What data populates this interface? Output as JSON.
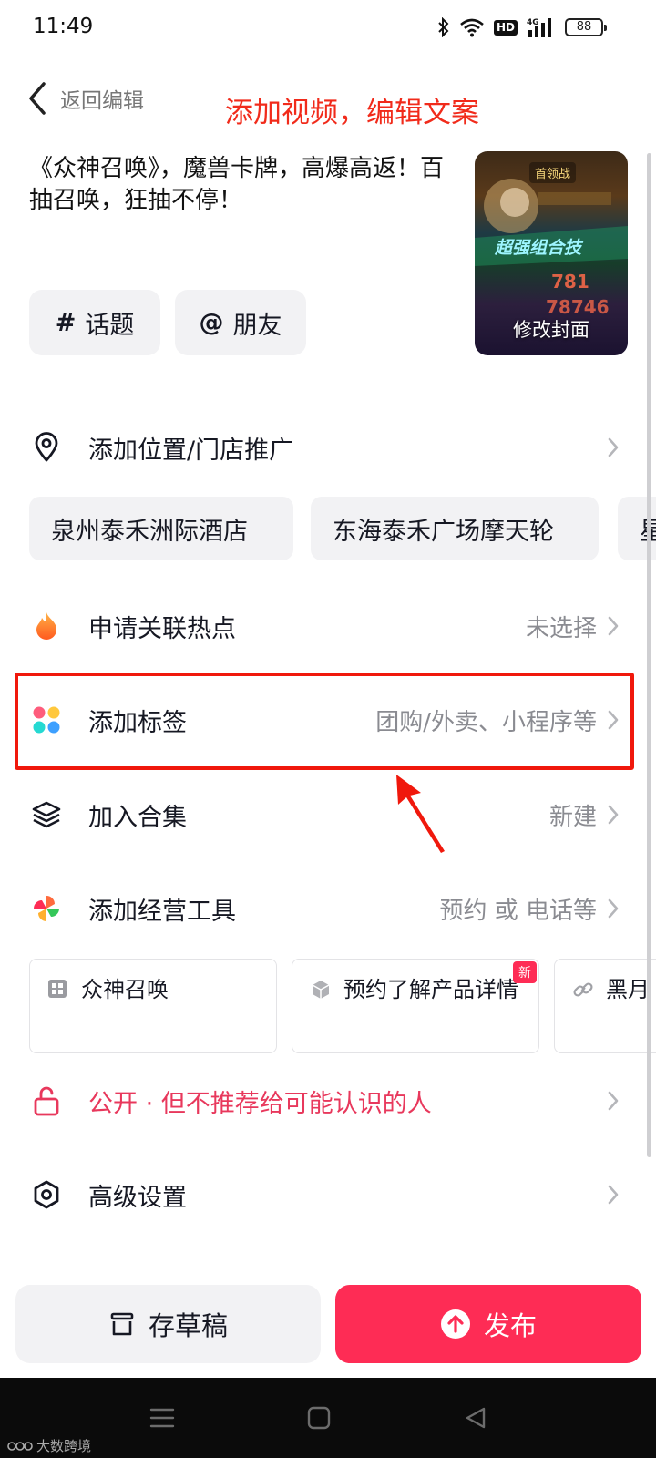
{
  "status_bar": {
    "time": "11:49",
    "network": "4G",
    "hd": "HD",
    "battery": "88"
  },
  "header": {
    "back_label": "返回编辑",
    "annotation": "添加视频，编辑文案"
  },
  "caption": "《众神召唤》，魔兽卡牌，高爆高返！百抽召唤，狂抽不停！",
  "cover": {
    "label": "修改封面",
    "art_text": "超强组合技",
    "badge": "首领战"
  },
  "chips": {
    "topic": {
      "symbol": "#",
      "label": "话题"
    },
    "friend": {
      "symbol": "@",
      "label": "朋友"
    }
  },
  "location": {
    "label": "添加位置/门店推广",
    "suggestions": [
      "泉州泰禾洲际酒店",
      "东海泰禾广场摩天轮",
      "星"
    ]
  },
  "hotspot": {
    "label": "申请关联热点",
    "value": "未选择"
  },
  "tags": {
    "label": "添加标签",
    "value": "团购/外卖、小程序等"
  },
  "collection": {
    "label": "加入合集",
    "value": "新建"
  },
  "business_tools": {
    "label": "添加经营工具",
    "value": "预约 或 电话等",
    "cards": [
      {
        "label": "众神召唤",
        "icon": "grid-icon",
        "badge": ""
      },
      {
        "label": "预约了解产品详情",
        "icon": "cube-icon",
        "badge": "新"
      },
      {
        "label": "黑月",
        "icon": "link-icon",
        "badge": ""
      }
    ]
  },
  "privacy": {
    "label": "公开 · 但不推荐给可能认识的人"
  },
  "advanced": {
    "label": "高级设置"
  },
  "actions": {
    "draft_label": "存草稿",
    "publish_label": "发布"
  },
  "watermark": "大数跨境",
  "colors": {
    "accent": "#fe2c55",
    "annotation_red": "#f12b1b",
    "privacy_red": "#e8385c",
    "secondary_text": "#8a8b91"
  }
}
